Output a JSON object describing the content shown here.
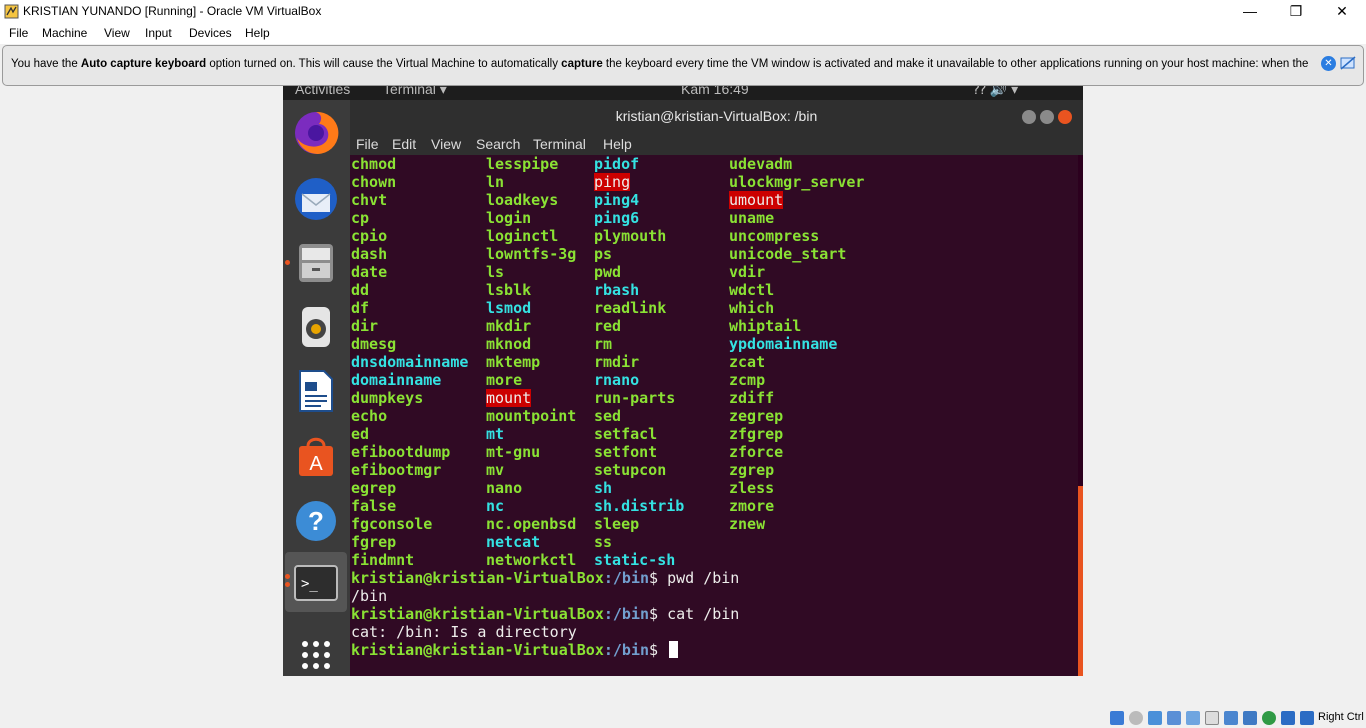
{
  "window": {
    "title": "KRISTIAN YUNANDO [Running] - Oracle VM VirtualBox",
    "minimize_glyph": "—",
    "maximize_glyph": "❐",
    "close_glyph": "✕"
  },
  "menu": [
    "File",
    "Machine",
    "View",
    "Input",
    "Devices",
    "Help"
  ],
  "notice": {
    "part1": "You have the ",
    "bold1": "Auto capture keyboard",
    "part2": " option turned on. This will cause the Virtual Machine to automatically ",
    "bold2": "capture",
    "part3": " the keyboard every time the VM window is activated and make it unavailable to other applications running on your host machine: when the keyboard is"
  },
  "guest_topbar": {
    "activities": "Activities",
    "terminal": "Terminal ▾",
    "clock": "Kam 16:49"
  },
  "terminal": {
    "title": "kristian@kristian-VirtualBox: /bin",
    "menu": [
      "File",
      "Edit",
      "View",
      "Search",
      "Terminal",
      "Help"
    ],
    "columns": [
      [
        {
          "t": "chmod",
          "s": "g"
        },
        {
          "t": "chown",
          "s": "g"
        },
        {
          "t": "chvt",
          "s": "g"
        },
        {
          "t": "cp",
          "s": "g"
        },
        {
          "t": "cpio",
          "s": "g"
        },
        {
          "t": "dash",
          "s": "g"
        },
        {
          "t": "date",
          "s": "g"
        },
        {
          "t": "dd",
          "s": "g"
        },
        {
          "t": "df",
          "s": "g"
        },
        {
          "t": "dir",
          "s": "g"
        },
        {
          "t": "dmesg",
          "s": "g"
        },
        {
          "t": "dnsdomainname",
          "s": "c"
        },
        {
          "t": "domainname",
          "s": "c"
        },
        {
          "t": "dumpkeys",
          "s": "g"
        },
        {
          "t": "echo",
          "s": "g"
        },
        {
          "t": "ed",
          "s": "g"
        },
        {
          "t": "efibootdump",
          "s": "g"
        },
        {
          "t": "efibootmgr",
          "s": "g"
        },
        {
          "t": "egrep",
          "s": "g"
        },
        {
          "t": "false",
          "s": "g"
        },
        {
          "t": "fgconsole",
          "s": "g"
        },
        {
          "t": "fgrep",
          "s": "g"
        },
        {
          "t": "findmnt",
          "s": "g"
        }
      ],
      [
        {
          "t": "lesspipe",
          "s": "g"
        },
        {
          "t": "ln",
          "s": "g"
        },
        {
          "t": "loadkeys",
          "s": "g"
        },
        {
          "t": "login",
          "s": "g"
        },
        {
          "t": "loginctl",
          "s": "g"
        },
        {
          "t": "lowntfs-3g",
          "s": "g"
        },
        {
          "t": "ls",
          "s": "g"
        },
        {
          "t": "lsblk",
          "s": "g"
        },
        {
          "t": "lsmod",
          "s": "c"
        },
        {
          "t": "mkdir",
          "s": "g"
        },
        {
          "t": "mknod",
          "s": "g"
        },
        {
          "t": "mktemp",
          "s": "g"
        },
        {
          "t": "more",
          "s": "g"
        },
        {
          "t": "mount",
          "s": "r"
        },
        {
          "t": "mountpoint",
          "s": "g"
        },
        {
          "t": "mt",
          "s": "c"
        },
        {
          "t": "mt-gnu",
          "s": "g"
        },
        {
          "t": "mv",
          "s": "g"
        },
        {
          "t": "nano",
          "s": "g"
        },
        {
          "t": "nc",
          "s": "c"
        },
        {
          "t": "nc.openbsd",
          "s": "g"
        },
        {
          "t": "netcat",
          "s": "c"
        },
        {
          "t": "networkctl",
          "s": "g"
        }
      ],
      [
        {
          "t": "pidof",
          "s": "c"
        },
        {
          "t": "ping",
          "s": "r"
        },
        {
          "t": "ping4",
          "s": "c"
        },
        {
          "t": "ping6",
          "s": "c"
        },
        {
          "t": "plymouth",
          "s": "g"
        },
        {
          "t": "ps",
          "s": "g"
        },
        {
          "t": "pwd",
          "s": "g"
        },
        {
          "t": "rbash",
          "s": "c"
        },
        {
          "t": "readlink",
          "s": "g"
        },
        {
          "t": "red",
          "s": "g"
        },
        {
          "t": "rm",
          "s": "g"
        },
        {
          "t": "rmdir",
          "s": "g"
        },
        {
          "t": "rnano",
          "s": "c"
        },
        {
          "t": "run-parts",
          "s": "g"
        },
        {
          "t": "sed",
          "s": "g"
        },
        {
          "t": "setfacl",
          "s": "g"
        },
        {
          "t": "setfont",
          "s": "g"
        },
        {
          "t": "setupcon",
          "s": "g"
        },
        {
          "t": "sh",
          "s": "c"
        },
        {
          "t": "sh.distrib",
          "s": "c"
        },
        {
          "t": "sleep",
          "s": "g"
        },
        {
          "t": "ss",
          "s": "g"
        },
        {
          "t": "static-sh",
          "s": "c"
        }
      ],
      [
        {
          "t": "udevadm",
          "s": "g"
        },
        {
          "t": "ulockmgr_server",
          "s": "g"
        },
        {
          "t": "umount",
          "s": "r"
        },
        {
          "t": "uname",
          "s": "g"
        },
        {
          "t": "uncompress",
          "s": "g"
        },
        {
          "t": "unicode_start",
          "s": "g"
        },
        {
          "t": "vdir",
          "s": "g"
        },
        {
          "t": "wdctl",
          "s": "g"
        },
        {
          "t": "which",
          "s": "g"
        },
        {
          "t": "whiptail",
          "s": "g"
        },
        {
          "t": "ypdomainname",
          "s": "c"
        },
        {
          "t": "zcat",
          "s": "g"
        },
        {
          "t": "zcmp",
          "s": "g"
        },
        {
          "t": "zdiff",
          "s": "g"
        },
        {
          "t": "zegrep",
          "s": "g"
        },
        {
          "t": "zfgrep",
          "s": "g"
        },
        {
          "t": "zforce",
          "s": "g"
        },
        {
          "t": "zgrep",
          "s": "g"
        },
        {
          "t": "zless",
          "s": "g"
        },
        {
          "t": "zmore",
          "s": "g"
        },
        {
          "t": "znew",
          "s": "g"
        }
      ]
    ],
    "session": [
      {
        "prompt": "kristian@kristian-VirtualBox",
        "path": ":/bin",
        "cmd": "$ pwd /bin"
      },
      {
        "output": "/bin"
      },
      {
        "prompt": "kristian@kristian-VirtualBox",
        "path": ":/bin",
        "cmd": "$ cat /bin"
      },
      {
        "output": "cat: /bin: Is a directory"
      },
      {
        "prompt": "kristian@kristian-VirtualBox",
        "path": ":/bin",
        "cmd": "$ "
      }
    ]
  },
  "status": {
    "host_key": "Right Ctrl"
  }
}
